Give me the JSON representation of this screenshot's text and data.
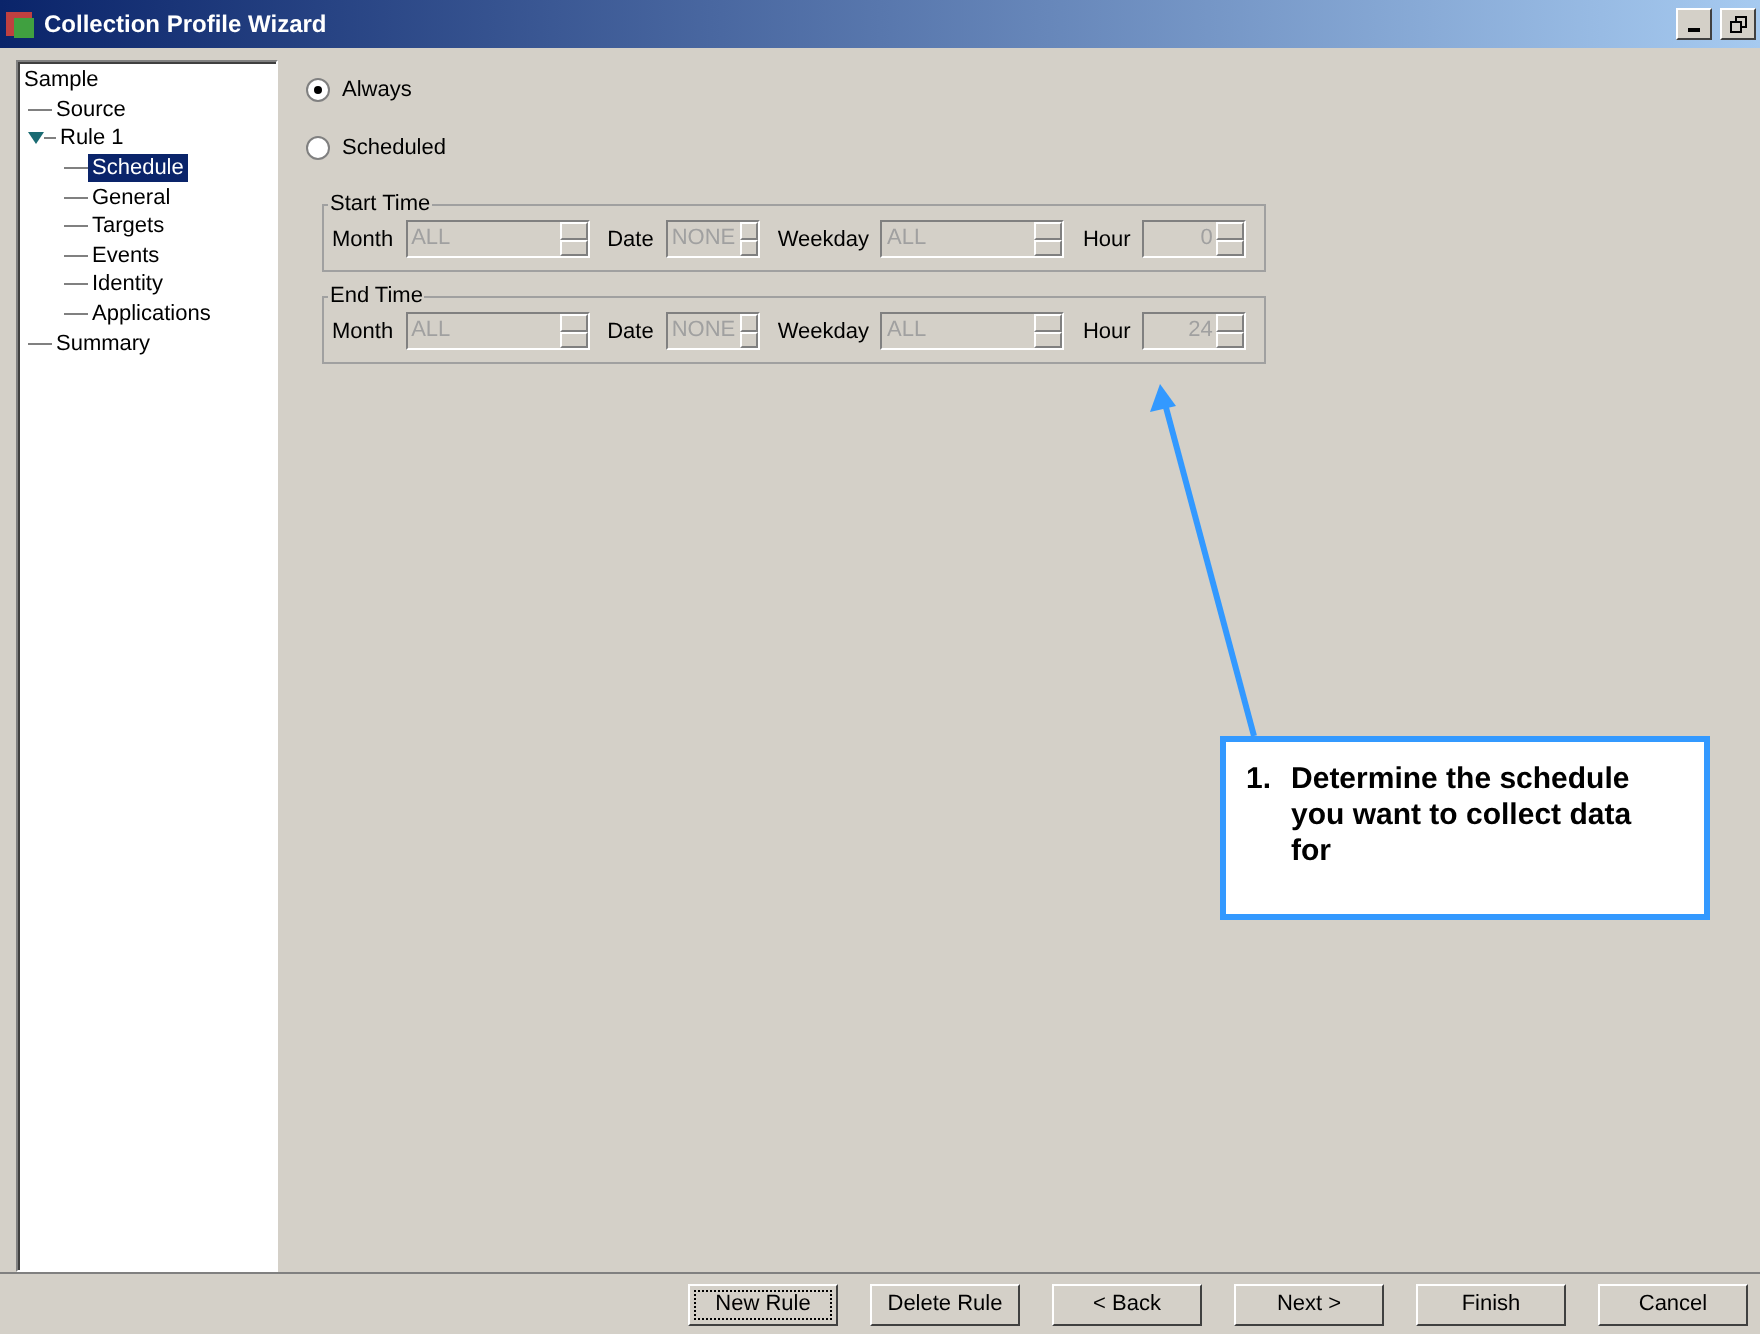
{
  "window": {
    "title": "Collection Profile Wizard"
  },
  "tree": [
    {
      "label": "Sample",
      "selected": false,
      "children": [
        {
          "label": "Source",
          "selected": false
        },
        {
          "label": "Rule 1",
          "selected": false,
          "expanded": true,
          "children": [
            {
              "label": "Schedule",
              "selected": true
            },
            {
              "label": "General",
              "selected": false
            },
            {
              "label": "Targets",
              "selected": false
            },
            {
              "label": "Events",
              "selected": false
            },
            {
              "label": "Identity",
              "selected": false
            },
            {
              "label": "Applications",
              "selected": false
            }
          ]
        },
        {
          "label": "Summary",
          "selected": false
        }
      ]
    }
  ],
  "radios": [
    {
      "label": "Always",
      "selected": true
    },
    {
      "label": "Scheduled",
      "selected": false
    }
  ],
  "groups": [
    {
      "title": "Start Time",
      "fields": [
        {
          "label": "Month",
          "value": "ALL",
          "kind": "wide",
          "disabled": true
        },
        {
          "label": "Date",
          "value": "NONE",
          "kind": "narrow",
          "disabled": true
        },
        {
          "label": "Weekday",
          "value": "ALL",
          "kind": "wide",
          "disabled": true
        },
        {
          "label": "Hour",
          "value": "0",
          "kind": "number",
          "disabled": true
        }
      ]
    },
    {
      "title": "End Time",
      "fields": [
        {
          "label": "Month",
          "value": "ALL",
          "kind": "wide",
          "disabled": true
        },
        {
          "label": "Date",
          "value": "NONE",
          "kind": "narrow",
          "disabled": true
        },
        {
          "label": "Weekday",
          "value": "ALL",
          "kind": "wide",
          "disabled": true
        },
        {
          "label": "Hour",
          "value": "24",
          "kind": "number",
          "disabled": true
        }
      ]
    }
  ],
  "callout": {
    "number": "1.",
    "text": "Determine the schedule you want to collect data for"
  },
  "buttons": [
    {
      "label": "New Rule",
      "focused": true
    },
    {
      "label": "Delete Rule",
      "focused": false
    },
    {
      "label": "< Back",
      "focused": false
    },
    {
      "label": "Next >",
      "focused": false
    },
    {
      "label": "Finish",
      "focused": false
    },
    {
      "label": "Cancel",
      "focused": false
    }
  ]
}
